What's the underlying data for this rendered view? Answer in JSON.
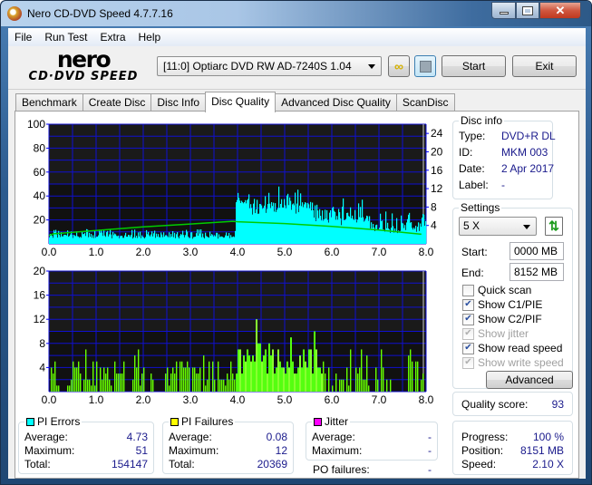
{
  "window": {
    "title": "Nero CD-DVD Speed 4.7.7.16"
  },
  "menu": [
    "File",
    "Run Test",
    "Extra",
    "Help"
  ],
  "logo": {
    "brand": "nero",
    "product": "CD·DVD SPEED"
  },
  "toolbar": {
    "drive": "[11:0]  Optiarc DVD RW AD-7240S 1.04",
    "start_label": "Start",
    "exit_label": "Exit"
  },
  "tabs": [
    {
      "label": "Benchmark",
      "active": false
    },
    {
      "label": "Create Disc",
      "active": false
    },
    {
      "label": "Disc Info",
      "active": false
    },
    {
      "label": "Disc Quality",
      "active": true
    },
    {
      "label": "Advanced Disc Quality",
      "active": false
    },
    {
      "label": "ScanDisc",
      "active": false
    }
  ],
  "disc_info": {
    "title": "Disc info",
    "type_label": "Type:",
    "type": "DVD+R DL",
    "id_label": "ID:",
    "id": "MKM 003",
    "date_label": "Date:",
    "date": "2 Apr 2017",
    "label_label": "Label:",
    "label": "-"
  },
  "settings": {
    "title": "Settings",
    "speed": "5 X",
    "start_label": "Start:",
    "start": "0000 MB",
    "end_label": "End:",
    "end": "8152 MB",
    "quick_scan": {
      "label": "Quick scan",
      "checked": false,
      "enabled": true
    },
    "show_c1": {
      "label": "Show C1/PIE",
      "checked": true,
      "enabled": true
    },
    "show_c2": {
      "label": "Show C2/PIF",
      "checked": true,
      "enabled": true
    },
    "show_jitter": {
      "label": "Show jitter",
      "checked": true,
      "enabled": false
    },
    "show_read": {
      "label": "Show read speed",
      "checked": true,
      "enabled": true
    },
    "show_write": {
      "label": "Show write speed",
      "checked": true,
      "enabled": false
    },
    "advanced_label": "Advanced"
  },
  "quality": {
    "label": "Quality score:",
    "value": "93"
  },
  "progress": {
    "progress_label": "Progress:",
    "progress": "100 %",
    "position_label": "Position:",
    "position": "8151 MB",
    "speed_label": "Speed:",
    "speed": "2.10 X"
  },
  "pi_errors": {
    "title": "PI Errors",
    "color": "#00ffff",
    "avg_label": "Average:",
    "avg": "4.73",
    "max_label": "Maximum:",
    "max": "51",
    "total_label": "Total:",
    "total": "154147"
  },
  "pi_failures": {
    "title": "PI Failures",
    "color": "#ffff00",
    "avg_label": "Average:",
    "avg": "0.08",
    "max_label": "Maximum:",
    "max": "12",
    "total_label": "Total:",
    "total": "20369"
  },
  "jitter": {
    "title": "Jitter",
    "color": "#ff00ff",
    "avg_label": "Average:",
    "avg": "-",
    "max_label": "Maximum:",
    "max": "-",
    "po_label": "PO failures:",
    "po": "-"
  },
  "chart_data": [
    {
      "type": "area",
      "title": "PI Errors",
      "xlim": [
        0,
        8.0
      ],
      "x_ticks": [
        "0.0",
        "1.0",
        "2.0",
        "3.0",
        "4.0",
        "5.0",
        "6.0",
        "7.0",
        "8.0"
      ],
      "ylim": [
        0,
        100
      ],
      "y_ticks": [
        "20",
        "40",
        "60",
        "80",
        "100"
      ],
      "y2lim": [
        0,
        26
      ],
      "y2_ticks": [
        "4",
        "8",
        "12",
        "16",
        "20",
        "24"
      ],
      "series": [
        {
          "name": "PI Errors",
          "color": "#00ffff",
          "segments": [
            {
              "x0": 0.0,
              "x1": 3.95,
              "base": 6,
              "peak": 13
            },
            {
              "x0": 3.95,
              "x1": 5.6,
              "base": 34,
              "peak": 51
            },
            {
              "x0": 5.6,
              "x1": 6.8,
              "base": 22,
              "peak": 38
            },
            {
              "x0": 6.8,
              "x1": 8.0,
              "base": 12,
              "peak": 30
            }
          ]
        },
        {
          "name": "Read speed",
          "color": "#00cc00",
          "axis": "y2",
          "points": [
            [
              0.0,
              1.8
            ],
            [
              0.1,
              2.2
            ],
            [
              1.0,
              2.9
            ],
            [
              2.0,
              3.7
            ],
            [
              3.0,
              4.3
            ],
            [
              3.9,
              4.9
            ],
            [
              4.0,
              4.8
            ],
            [
              5.0,
              4.4
            ],
            [
              6.0,
              3.8
            ],
            [
              7.0,
              3.0
            ],
            [
              7.9,
              2.1
            ]
          ]
        }
      ]
    },
    {
      "type": "bar",
      "title": "PI Failures",
      "xlim": [
        0,
        8.0
      ],
      "x_ticks": [
        "0.0",
        "1.0",
        "2.0",
        "3.0",
        "4.0",
        "5.0",
        "6.0",
        "7.0",
        "8.0"
      ],
      "ylim": [
        0,
        20
      ],
      "y_ticks": [
        "4",
        "8",
        "12",
        "16",
        "20"
      ],
      "series": [
        {
          "name": "PI Failures",
          "color": "#66ff00",
          "max": 12,
          "peak_x": 4.4
        }
      ]
    }
  ]
}
